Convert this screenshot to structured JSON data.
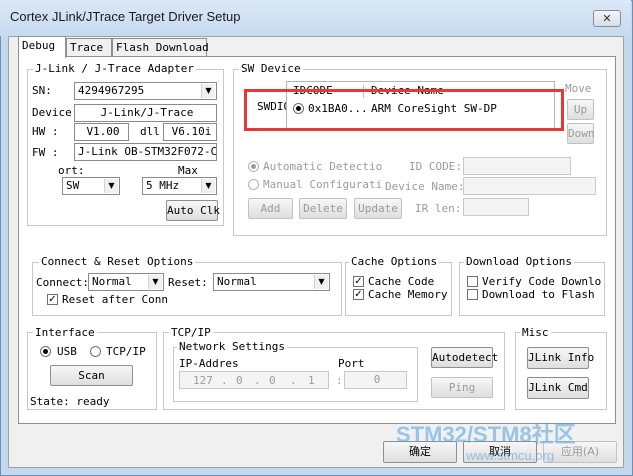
{
  "window": {
    "title": "Cortex JLink/JTrace Target Driver Setup",
    "close_icon": "close-icon"
  },
  "tabs": [
    "Debug",
    "Trace",
    "Flash Download"
  ],
  "adapter": {
    "legend": "J-Link / J-Trace Adapter",
    "sn_label": "SN:",
    "sn_value": "4294967295",
    "device_label": "Device:",
    "device_value": "J-Link/J-Trace",
    "hw_label": "HW :",
    "hw_value": "V1.00",
    "dll_label": "dll",
    "dll_value": "V6.10i",
    "fw_label": "FW :",
    "fw_value": "J-Link OB-STM32F072-Cor",
    "port_label": "ort:",
    "port_value": "SW",
    "max_label": "Max",
    "max_value": "5 MHz",
    "auto_clk": "Auto Clk"
  },
  "sw_device": {
    "legend": "SW Device",
    "swdio_label": "SWDIO",
    "col_idcode": "IDCODE",
    "col_device": "Device Name",
    "rows": [
      {
        "idcode": "0x1BA0...",
        "device": "ARM CoreSight SW-DP",
        "selected": true
      }
    ],
    "move_label": "Move",
    "up": "Up",
    "down": "Down",
    "auto_detect": "Automatic Detectio",
    "manual_config": "Manual Configurati",
    "id_code_label": "ID CODE:",
    "device_name_label": "Device Name:",
    "ir_len_label": "IR len:",
    "add": "Add",
    "delete": "Delete",
    "update": "Update",
    "highlight_color": "#e53935"
  },
  "connect_reset": {
    "legend": "Connect & Reset Options",
    "connect_label": "Connect:",
    "connect_value": "Normal",
    "reset_label": "Reset:",
    "reset_value": "Normal",
    "reset_after_conn": "Reset after Conn",
    "reset_after_conn_checked": true
  },
  "cache": {
    "legend": "Cache Options",
    "cache_code": "Cache Code",
    "cache_code_checked": true,
    "cache_memory": "Cache Memory",
    "cache_memory_checked": true
  },
  "download": {
    "legend": "Download Options",
    "verify": "Verify Code Downlo",
    "verify_checked": false,
    "download_flash": "Download to Flash",
    "download_flash_checked": false
  },
  "interface": {
    "legend": "Interface",
    "usb": "USB",
    "usb_selected": true,
    "tcpip": "TCP/IP",
    "tcpip_selected": false,
    "scan": "Scan",
    "state": "State: ready"
  },
  "tcpip": {
    "legend": "TCP/IP",
    "network_legend": "Network Settings",
    "ip_label": "IP-Addres",
    "ip": [
      "127",
      "0",
      "0",
      "1"
    ],
    "port_label": "Port",
    "port_value": "0",
    "autodetect": "Autodetect",
    "ping": "Ping"
  },
  "misc": {
    "legend": "Misc",
    "jlink_info": "JLink Info",
    "jlink_cmd": "JLink Cmd"
  },
  "footer": {
    "ok": "确定",
    "cancel": "取消",
    "apply": "应用(A)"
  },
  "watermark": {
    "text": "STM32/STM8社区",
    "url": "www.stmcu.org"
  }
}
